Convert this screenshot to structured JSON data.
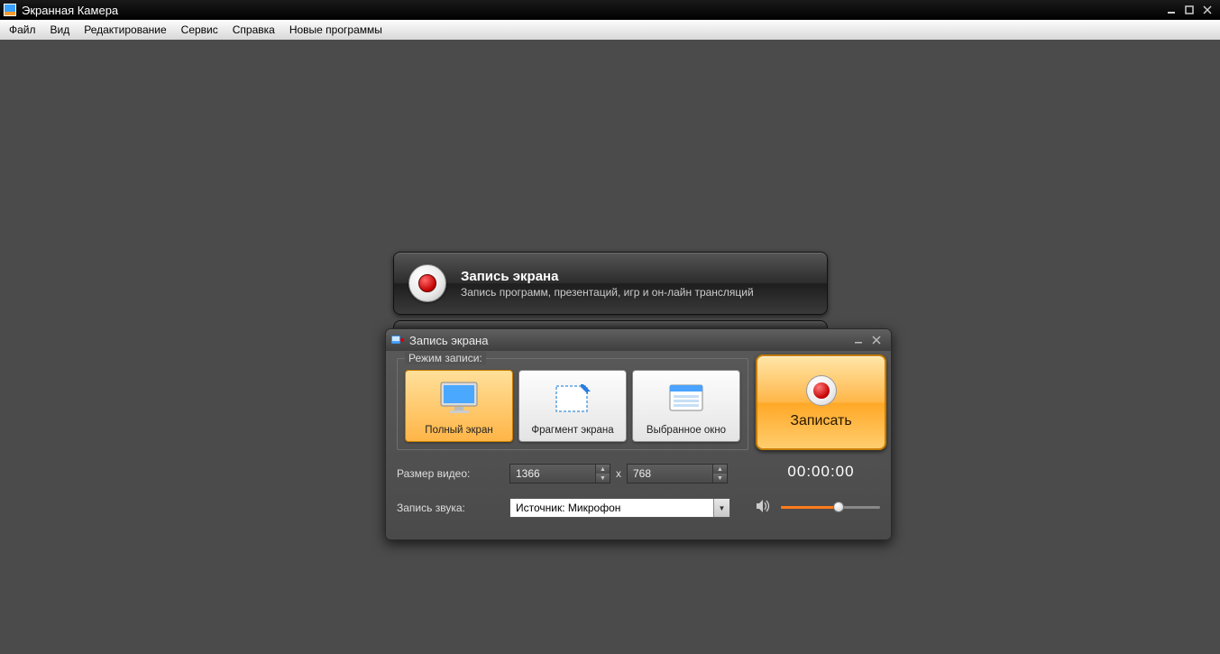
{
  "app": {
    "title": "Экранная Камера"
  },
  "menu": {
    "file": "Файл",
    "view": "Вид",
    "edit": "Редактирование",
    "service": "Сервис",
    "help": "Справка",
    "new_programs": "Новые программы"
  },
  "banner": {
    "title": "Запись экрана",
    "subtitle": "Запись программ, презентаций, игр и он-лайн трансляций"
  },
  "dialog": {
    "title": "Запись экрана",
    "mode_label": "Режим записи:",
    "modes": {
      "fullscreen": "Полный экран",
      "fragment": "Фрагмент экрана",
      "window": "Выбранное окно"
    },
    "record_label": "Записать",
    "timer": "00:00:00",
    "size_label": "Размер видео:",
    "width": "1366",
    "x": "x",
    "height": "768",
    "sound_label": "Запись звука:",
    "source": "Источник: Микрофон"
  }
}
